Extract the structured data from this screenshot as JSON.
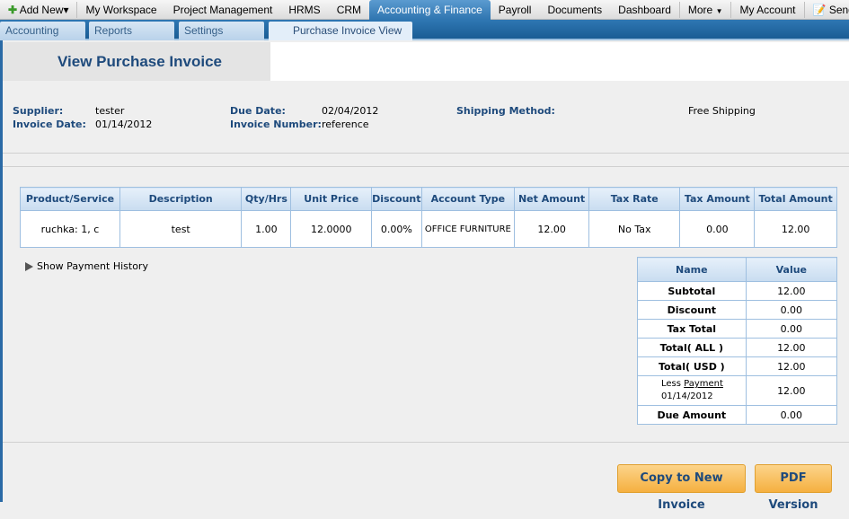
{
  "topnav": {
    "add_new": "Add New",
    "items": [
      "My Workspace",
      "Project Management",
      "HRMS",
      "CRM",
      "Accounting & Finance",
      "Payroll",
      "Documents",
      "Dashboard"
    ],
    "more": "More",
    "my_account": "My Account",
    "send_feedback": "Send feed"
  },
  "subnav": {
    "tabs": [
      "Accounting",
      "Reports",
      "Settings"
    ],
    "active_tab": "Purchase Invoice View"
  },
  "page_title": "View Purchase Invoice",
  "info": {
    "supplier_label": "Supplier:",
    "supplier": "tester",
    "invoice_date_label": "Invoice Date:",
    "invoice_date": "01/14/2012",
    "due_date_label": "Due Date:",
    "due_date": "02/04/2012",
    "invoice_number_label": "Invoice Number:",
    "invoice_number": "reference",
    "shipping_label": "Shipping Method:",
    "shipping": "Free Shipping"
  },
  "items": {
    "headers": [
      "Product/Service",
      "Description",
      "Qty/Hrs",
      "Unit Price",
      "Discount",
      "Account Type",
      "Net Amount",
      "Tax Rate",
      "Tax Amount",
      "Total Amount"
    ],
    "rows": [
      [
        "ruchka: 1, c",
        "test",
        "1.00",
        "12.0000",
        "0.00%",
        "OFFICE FURNITURE",
        "12.00",
        "No Tax",
        "0.00",
        "12.00"
      ]
    ]
  },
  "payment_history": "Show Payment History",
  "summary": {
    "headers": [
      "Name",
      "Value"
    ],
    "rows": [
      {
        "name": "Subtotal",
        "value": "12.00"
      },
      {
        "name": "Discount",
        "value": "0.00"
      },
      {
        "name": "Tax Total",
        "value": "0.00"
      },
      {
        "name": "Total( ALL )",
        "value": "12.00"
      },
      {
        "name": "Total( USD )",
        "value": "12.00"
      }
    ],
    "payment": {
      "less": "Less",
      "link": "Payment",
      "date": "01/14/2012",
      "value": "12.00"
    },
    "due": {
      "name": "Due Amount",
      "value": "0.00"
    }
  },
  "buttons": {
    "copy": "Copy to New Invoice",
    "pdf": "PDF Version"
  }
}
